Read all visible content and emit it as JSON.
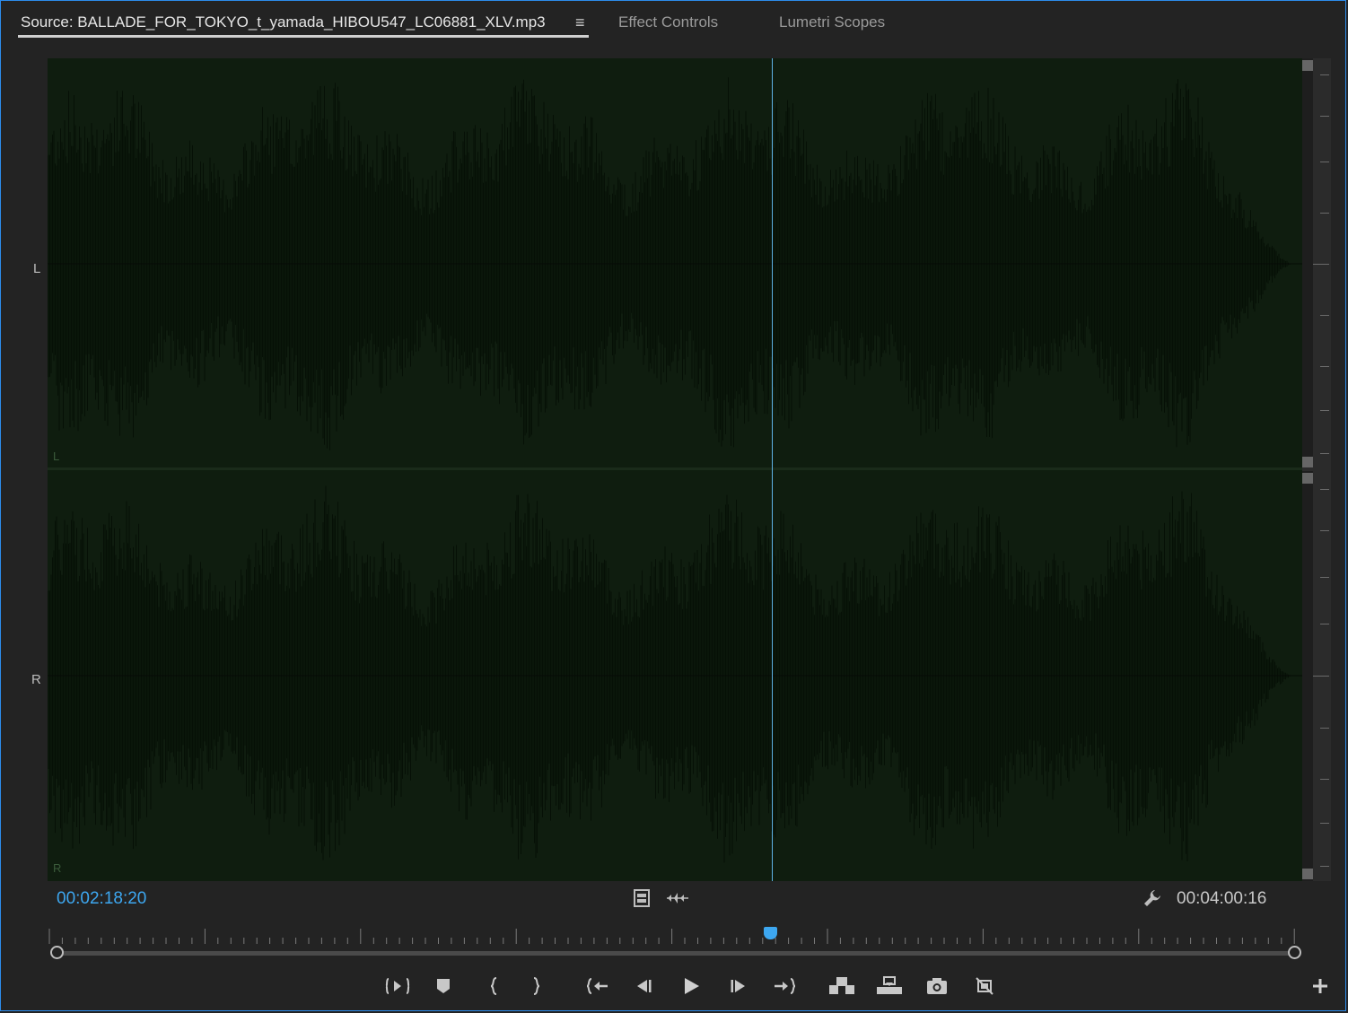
{
  "tabs": {
    "source": "Source: BALLADE_FOR_TOKYO_t_yamada_HIBOU547_LC06881_XLV.mp3",
    "menu_icon": "hamburger-menu-icon",
    "effect_controls": "Effect Controls",
    "lumetri_scopes": "Lumetri Scopes"
  },
  "channels": {
    "left": "L",
    "right": "R"
  },
  "timecodes": {
    "current": "00:02:18:20",
    "duration": "00:04:00:16"
  },
  "playhead_fraction": 0.577,
  "colors": {
    "accent": "#3da7f0",
    "waveform_bg": "#0f1d0f",
    "waveform": "#061006",
    "panel_border": "#2d8ceb"
  },
  "controls": {
    "settings_icon": "wrench-icon",
    "drag_video_icon": "film-icon",
    "drag_audio_icon": "audio-waveform-icon",
    "transport": [
      "mark-in-out-icon",
      "add-marker-icon",
      "mark-in-icon",
      "mark-out-icon",
      "go-to-in-icon",
      "step-back-icon",
      "play-icon",
      "step-forward-icon",
      "go-to-out-icon",
      "insert-icon",
      "overwrite-icon",
      "export-frame-icon",
      "toggle-proxy-icon"
    ],
    "add_button_icon": "plus-icon"
  }
}
